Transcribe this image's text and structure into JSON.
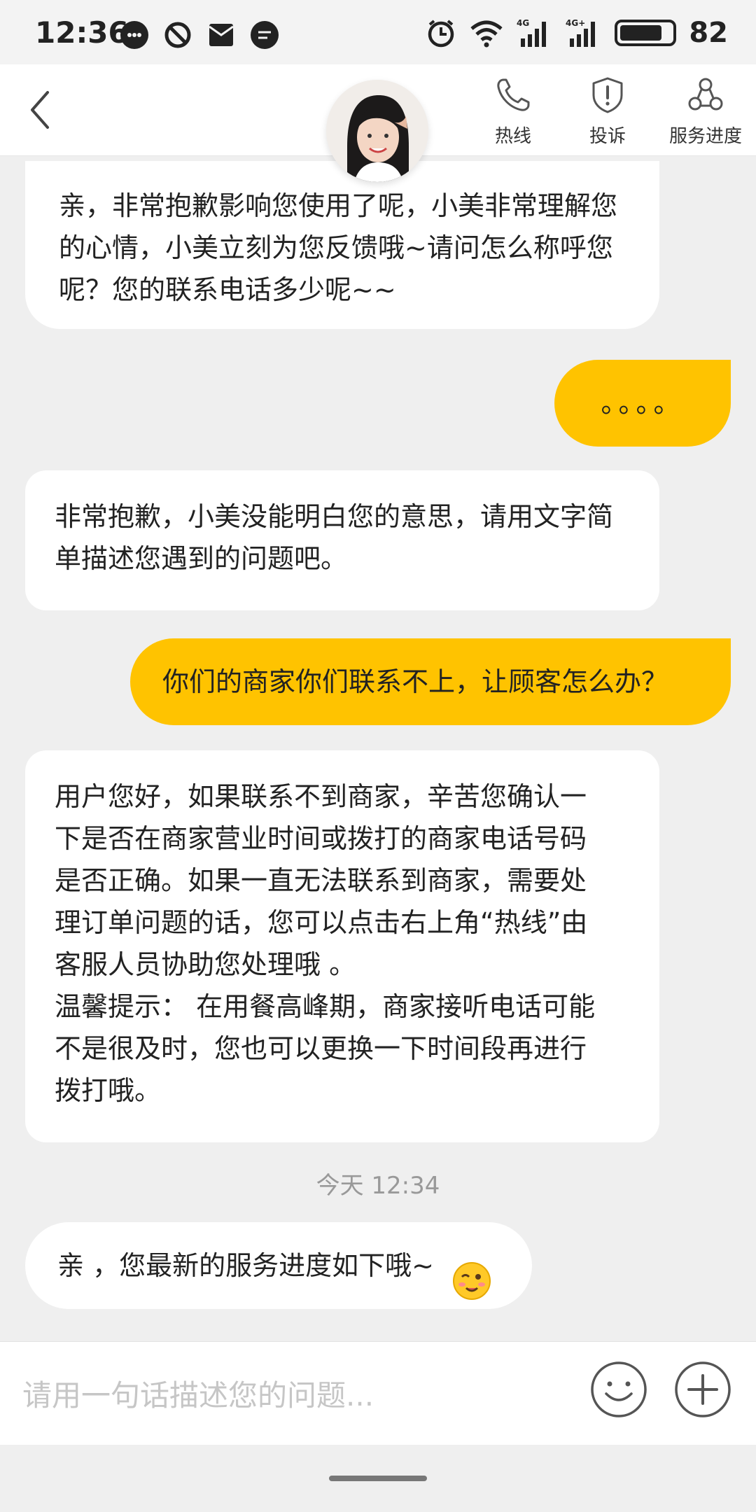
{
  "status_bar": {
    "time": "12:36",
    "battery": "82",
    "icons": [
      "chat-bubble-icon",
      "block-icon",
      "mail-icon",
      "message-icon",
      "alarm-icon",
      "wifi-icon",
      "signal-4g-icon",
      "signal-4g-plus-icon",
      "battery-icon"
    ]
  },
  "header": {
    "actions": [
      {
        "label": "热线",
        "icon": "phone-icon"
      },
      {
        "label": "投诉",
        "icon": "shield-alert-icon"
      },
      {
        "label": "服务进度",
        "icon": "progress-icon"
      }
    ]
  },
  "messages": [
    {
      "from": "agent",
      "text": "亲，非常抱歉影响您使用了呢，小美非常理解您的心情，小美立刻为您反馈哦~请问怎么称呼您呢？您的联系电话多少呢~~"
    },
    {
      "from": "user",
      "text": "。。。。"
    },
    {
      "from": "agent",
      "text": "非常抱歉，小美没能明白您的意思，请用文字简单描述您遇到的问题吧。"
    },
    {
      "from": "user",
      "text": "你们的商家你们联系不上，让顾客怎么办？"
    },
    {
      "from": "agent",
      "text_lines": [
        "用户您好，如果联系不到商家，辛苦您确认一",
        "下是否在商家营业时间或拨打的商家电话号码",
        "是否正确。如果一直无法联系到商家，需要处",
        "理订单问题的话，您可以点击右上角“热线”由",
        "客服人员协助您处理哦 。",
        "温馨提示： 在用餐高峰期，商家接听电话可能",
        "不是很及时，您也可以更换一下时间段再进行",
        "拨打哦。"
      ]
    },
    {
      "from": "system",
      "text": "今天 12:34"
    },
    {
      "from": "agent",
      "text": "亲 ，您最新的服务进度如下哦~",
      "emoji": "wink-emoji-icon"
    }
  ],
  "input": {
    "placeholder": "请用一句话描述您的问题..."
  },
  "colors": {
    "accent": "#ffc300",
    "background": "#efefef",
    "bubble": "#ffffff"
  }
}
